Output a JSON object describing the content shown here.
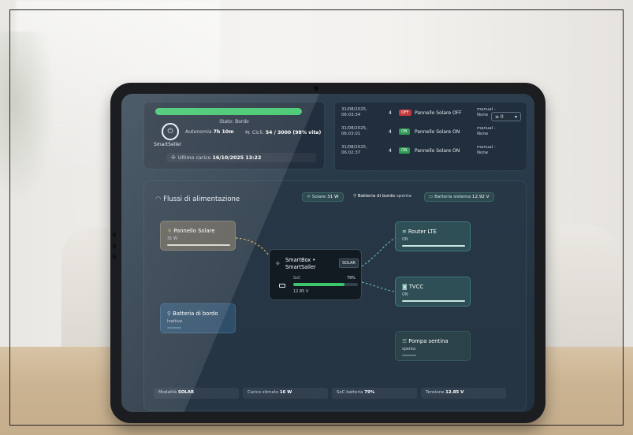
{
  "status": {
    "state_label": "Stato: Bordo",
    "brand": "SmartSeller",
    "autonomy_label": "Autonomia",
    "autonomy_value": "7h 10m",
    "cycles_label": "Cicli",
    "cycles_value": "54 / 3000 (98% vita)",
    "last_label": "Ultimo carico",
    "last_value": "16/10/2025 13:22"
  },
  "log": {
    "filter": "≥ 0",
    "rows": [
      {
        "ts": "31/08/2025, 06:03:34",
        "num": "4",
        "badge": "OFF",
        "badge_color": "#c23a3a",
        "event": "Pannello Solare OFF",
        "source": "manual - None"
      },
      {
        "ts": "31/08/2025, 06:03:01",
        "num": "4",
        "badge": "ON",
        "badge_color": "#2f9a55",
        "event": "Pannello Solare ON",
        "source": "manual - None"
      },
      {
        "ts": "31/08/2025, 06:02:37",
        "num": "4",
        "badge": "ON",
        "badge_color": "#2f9a55",
        "event": "Pannello Solare ON",
        "source": "manual - None"
      }
    ]
  },
  "flows": {
    "title": "Flussi di alimentazione",
    "chips": [
      {
        "label": "Solare",
        "value": "31 W"
      },
      {
        "label": "Batteria di bordo",
        "value": "spenta"
      },
      {
        "label": "Batteria sistema",
        "value": "12.92 V"
      }
    ],
    "solar": {
      "title": "Pannello Solare",
      "sub": "31 W"
    },
    "battery": {
      "title": "Batteria di bordo",
      "sub": "Inattiva"
    },
    "hub": {
      "title_line1": "SmartBox •",
      "title_line2": "SmartSailer",
      "badge": "SOLAR",
      "soc_label": "SoC",
      "soc_pct": "79%",
      "soc_fraction": 0.79,
      "voltage": "12.85 V"
    },
    "router": {
      "title": "Router LTE",
      "sub": "ON"
    },
    "tvcc": {
      "title": "TVCC",
      "sub": "ON"
    },
    "pump": {
      "title": "Pompa sentina",
      "sub": "spenta"
    },
    "footer": [
      {
        "label": "Modalità",
        "value": "SOLAR"
      },
      {
        "label": "Carico stimato",
        "value": "16 W"
      },
      {
        "label": "SoC batteria",
        "value": "79%"
      },
      {
        "label": "Tensione",
        "value": "12.85 V"
      }
    ]
  },
  "colors": {
    "accent_green": "#3cc56a",
    "dashed_yellow": "#d9b34a",
    "dashed_teal": "#5fb8b0"
  }
}
